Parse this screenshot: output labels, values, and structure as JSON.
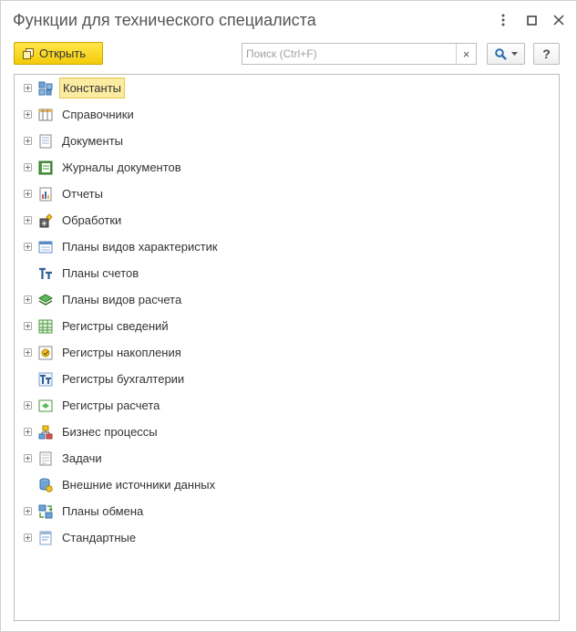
{
  "window": {
    "title": "Функции для технического специалиста"
  },
  "toolbar": {
    "open_label": "Открыть",
    "search_placeholder": "Поиск (Ctrl+F)",
    "search_value": "",
    "clear_label": "×",
    "help_label": "?"
  },
  "colors": {
    "open_button": "#f5d20f",
    "selection": "#fbeca1",
    "selection_border": "#e6c845"
  },
  "tree": {
    "items": [
      {
        "label": "Константы",
        "icon": "constants-icon",
        "expandable": true,
        "selected": true
      },
      {
        "label": "Справочники",
        "icon": "catalogs-icon",
        "expandable": true,
        "selected": false
      },
      {
        "label": "Документы",
        "icon": "documents-icon",
        "expandable": true,
        "selected": false
      },
      {
        "label": "Журналы документов",
        "icon": "document-journals-icon",
        "expandable": true,
        "selected": false
      },
      {
        "label": "Отчеты",
        "icon": "reports-icon",
        "expandable": true,
        "selected": false
      },
      {
        "label": "Обработки",
        "icon": "data-processors-icon",
        "expandable": true,
        "selected": false
      },
      {
        "label": "Планы видов характеристик",
        "icon": "characteristic-types-icon",
        "expandable": true,
        "selected": false
      },
      {
        "label": "Планы счетов",
        "icon": "chart-of-accounts-icon",
        "expandable": false,
        "selected": false
      },
      {
        "label": "Планы видов расчета",
        "icon": "calculation-types-icon",
        "expandable": true,
        "selected": false
      },
      {
        "label": "Регистры сведений",
        "icon": "information-registers-icon",
        "expandable": true,
        "selected": false
      },
      {
        "label": "Регистры накопления",
        "icon": "accumulation-registers-icon",
        "expandable": true,
        "selected": false
      },
      {
        "label": "Регистры бухгалтерии",
        "icon": "accounting-registers-icon",
        "expandable": false,
        "selected": false
      },
      {
        "label": "Регистры расчета",
        "icon": "calculation-registers-icon",
        "expandable": true,
        "selected": false
      },
      {
        "label": "Бизнес процессы",
        "icon": "business-processes-icon",
        "expandable": true,
        "selected": false
      },
      {
        "label": "Задачи",
        "icon": "tasks-icon",
        "expandable": true,
        "selected": false
      },
      {
        "label": "Внешние источники данных",
        "icon": "external-data-sources-icon",
        "expandable": false,
        "selected": false
      },
      {
        "label": "Планы обмена",
        "icon": "exchange-plans-icon",
        "expandable": true,
        "selected": false
      },
      {
        "label": "Стандартные",
        "icon": "standard-icon",
        "expandable": true,
        "selected": false
      }
    ]
  }
}
